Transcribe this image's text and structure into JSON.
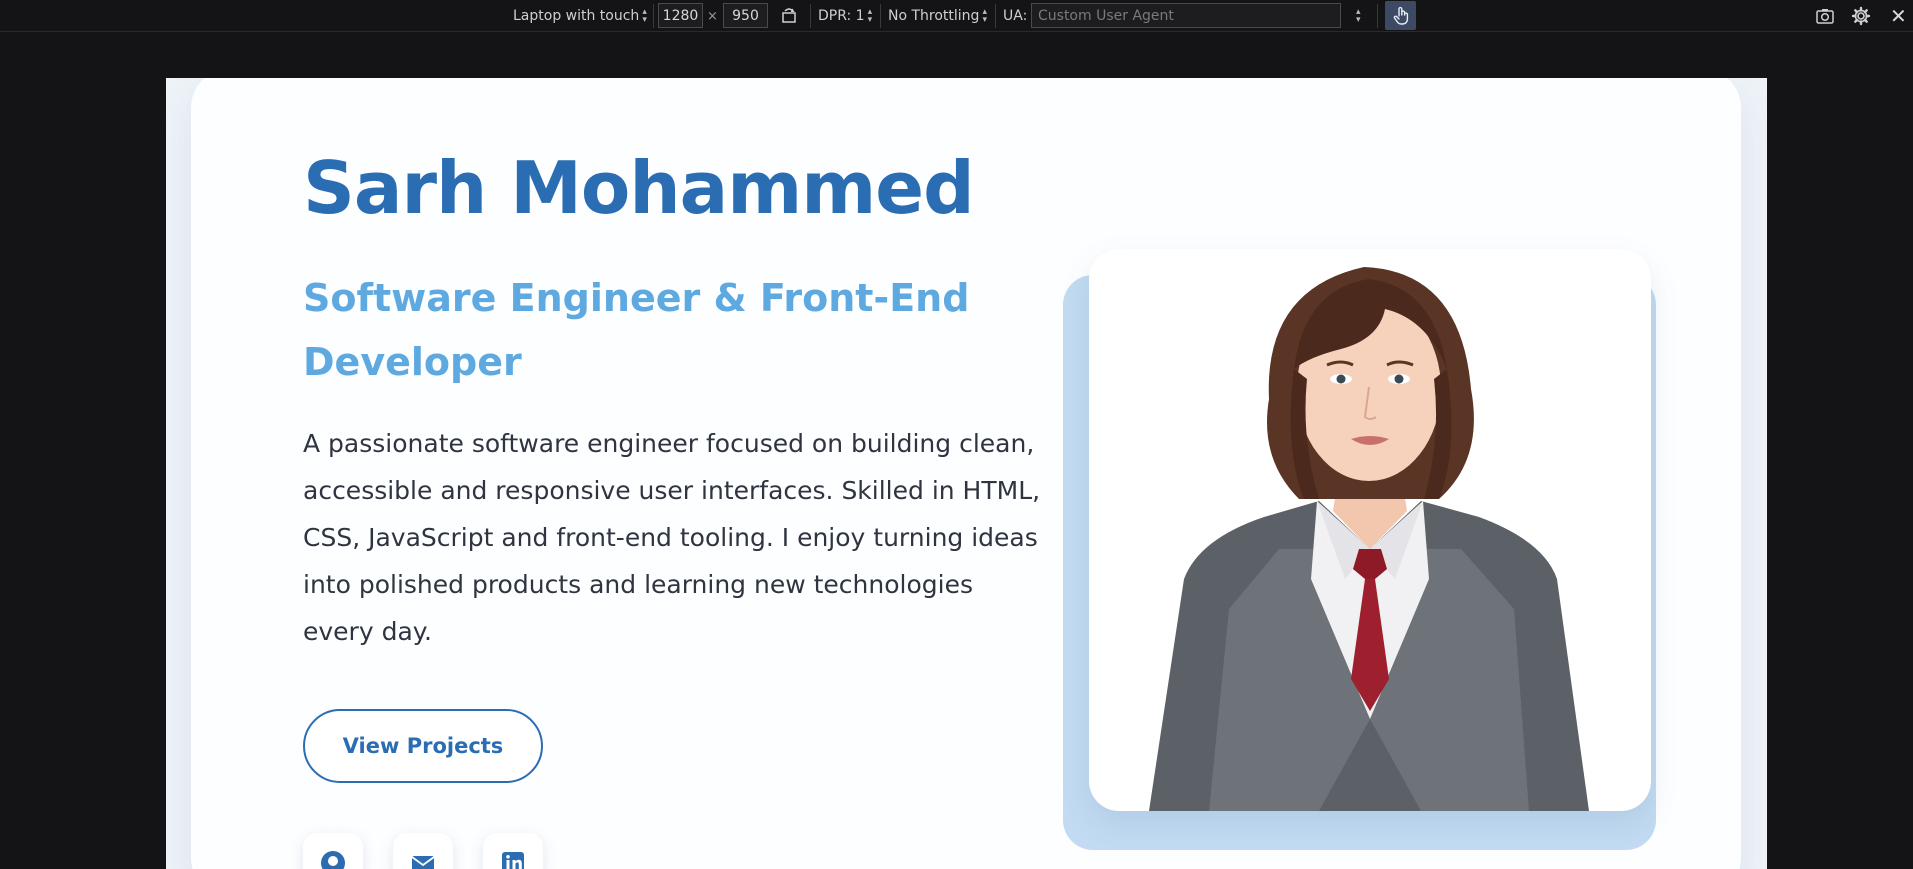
{
  "devtools": {
    "device": "Laptop with touch",
    "width": "1280",
    "times": "×",
    "height": "950",
    "dpr": "DPR: 1",
    "throttling": "No Throttling",
    "ua_label": "UA:",
    "ua_placeholder": "Custom User Agent"
  },
  "hero": {
    "name": "Sarh Mohammed",
    "role": "Software Engineer & Front-End Developer",
    "bio": "A passionate software engineer focused on building clean, accessible and responsive user interfaces. Skilled in HTML, CSS, JavaScript and front-end tooling. I enjoy turning ideas into polished products and learning new technologies every day.",
    "cta_label": "View Projects"
  },
  "colors": {
    "name": "#2b6db2",
    "role": "#5ea9e0",
    "photo_back": "#c2dbf2"
  }
}
